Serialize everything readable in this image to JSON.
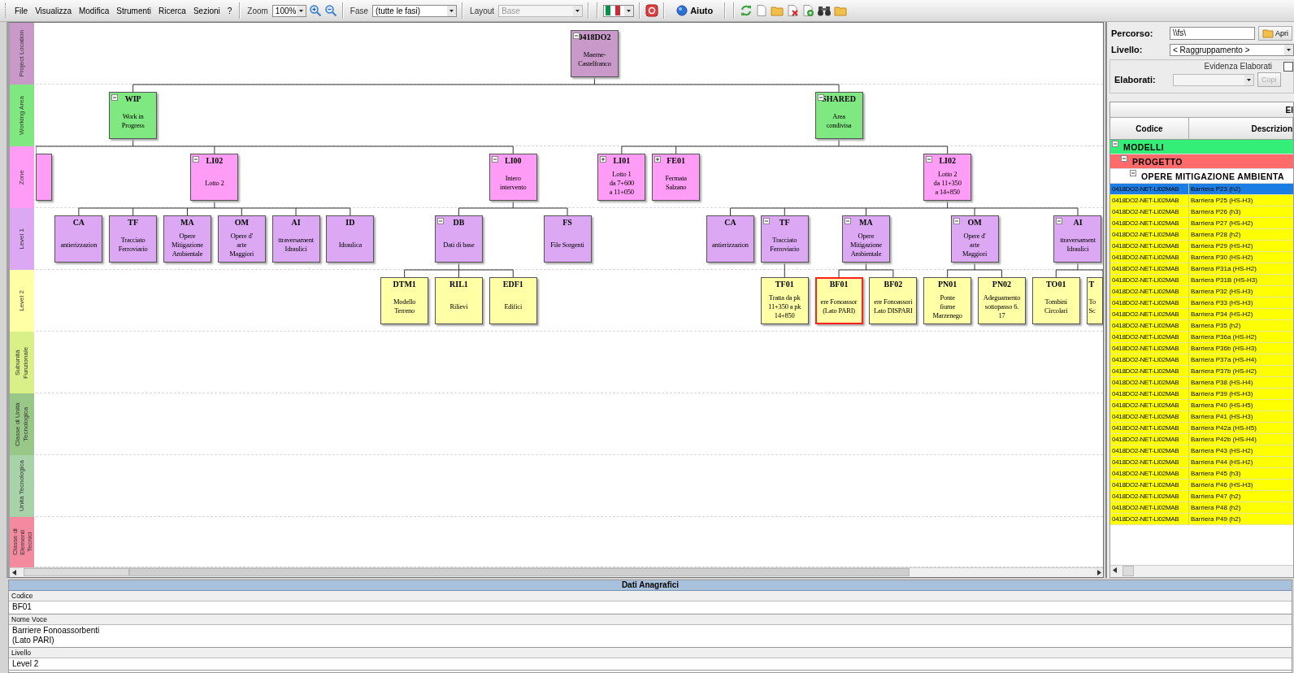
{
  "toolbar": {
    "menus": [
      "File",
      "Visualizza",
      "Modifica",
      "Strumenti",
      "Ricerca",
      "Sezioni",
      "?"
    ],
    "zoom": {
      "label": "Zoom",
      "value": "100%"
    },
    "phase": {
      "label": "Fase",
      "value": "(tutte le fasi)"
    },
    "layout": {
      "label": "Layout",
      "value": "Base",
      "disabled": true
    },
    "help_button": "Aiuto"
  },
  "bands": [
    {
      "label": "Project Location",
      "color": "#c99ac9"
    },
    {
      "label": "Working Area",
      "color": "#80e880"
    },
    {
      "label": "Zone",
      "color": "#ff9cf5"
    },
    {
      "label": "Level 1",
      "color": "#dca8f4"
    },
    {
      "label": "Level 2",
      "color": "#ffffa6"
    },
    {
      "label": "Subunità Funzionale",
      "color": "#d9ef88"
    },
    {
      "label": "Classe di Unità Tecnologica",
      "color": "#98c787"
    },
    {
      "label": "Unità Tecnologica",
      "color": "#a8d2a8"
    },
    {
      "label": "Classe di Elementi Tecnici",
      "color": "#f48aa0"
    }
  ],
  "tree": {
    "code": "0418DO2",
    "description": "Maerne-\nCastelfranco",
    "selected": false,
    "expanded": true,
    "children": [
      {
        "code": "WIP",
        "description": "Work in\nProgress",
        "selected": false,
        "expanded": true,
        "children": [
          {
            "kind": "clipped-left",
            "selected": false
          },
          {
            "code": "LI02",
            "description": "Lotto 2",
            "selected": false,
            "expanded": true,
            "children": [
              {
                "code": "CA",
                "description": "antierizzazion",
                "selected": false
              },
              {
                "code": "TF",
                "description": "Tracciato\nFerroviario",
                "selected": false
              },
              {
                "code": "MA",
                "description": "Opere\nMitigazione\nAmbientale",
                "selected": false
              },
              {
                "code": "OM",
                "description": "Opere d'\narte\nMaggiori",
                "selected": false
              },
              {
                "code": "AI",
                "description": "ttraversament\nIdraulici",
                "selected": false
              },
              {
                "code": "ID",
                "description": "Idraulica",
                "selected": false
              }
            ]
          },
          {
            "code": "LI00",
            "description": "Intero\nintervento",
            "selected": false,
            "expanded": true,
            "children": [
              {
                "code": "DB",
                "description": "Dati di base",
                "selected": false,
                "expanded": true,
                "children": [
                  {
                    "code": "DTM1",
                    "description": "Modello\nTerreno",
                    "selected": false
                  },
                  {
                    "code": "RIL1",
                    "description": "Rilievi",
                    "selected": false
                  },
                  {
                    "code": "EDF1",
                    "description": "Edifici",
                    "selected": false
                  }
                ]
              },
              {
                "code": "FS",
                "description": "File Sorgenti",
                "selected": false
              }
            ]
          }
        ]
      },
      {
        "code": "SHARED",
        "description": "Area\ncondivisa",
        "selected": false,
        "expanded": true,
        "children": [
          {
            "code": "LI01",
            "description": "Lotto 1\nda 7+600\na 11+050",
            "selected": false,
            "expanded": false
          },
          {
            "code": "FE01",
            "description": "Fermata\nSalzano",
            "selected": false,
            "expanded": false
          },
          {
            "code": "LI02",
            "description": "Lotto 2\nda 11+350\na 14+850",
            "selected": false,
            "expanded": true,
            "children": [
              {
                "code": "CA",
                "description": "antierizzazion",
                "selected": false
              },
              {
                "code": "TF",
                "description": "Tracciato\nFerroviario",
                "selected": false,
                "expanded": true,
                "children": [
                  {
                    "code": "TF01",
                    "description": "Tratta da pk\n11+350 a pk\n14+850",
                    "selected": false
                  }
                ]
              },
              {
                "code": "MA",
                "description": "Opere\nMitigazione\nAmbientale",
                "selected": false,
                "expanded": true,
                "children": [
                  {
                    "code": "BF01",
                    "description": "ere Fonoassor\n(Lato PARI)",
                    "selected": true
                  },
                  {
                    "code": "BF02",
                    "description": "ere Fonoassori\nLato DISPARI",
                    "selected": false
                  }
                ]
              },
              {
                "code": "OM",
                "description": "Opere d'\narte\nMaggiori",
                "selected": false,
                "expanded": true,
                "children": [
                  {
                    "code": "PN01",
                    "description": "Ponte\nfiume\nMarzenego",
                    "selected": false
                  },
                  {
                    "code": "PN02",
                    "description": "Adeguamento\nsottopasso 6.\n17",
                    "selected": false
                  }
                ]
              },
              {
                "code": "AI",
                "description": "ttraversament\nIdraulici",
                "selected": false,
                "expanded": true,
                "children": [
                  {
                    "code": "TO01",
                    "description": "Tombini\nCircolari",
                    "selected": false
                  },
                  {
                    "kind": "clipped-right",
                    "code": "T",
                    "description": "To\nSc",
                    "selected": false
                  }
                ]
              }
            ]
          }
        ]
      }
    ]
  },
  "side_panel": {
    "path": {
      "label": "Percorso:",
      "value": "\\\\fs\\"
    },
    "open_button": "Apri",
    "level": {
      "label": "Livello:",
      "value": "< Raggruppamento >"
    },
    "highlight": {
      "label": "Evidenza Elaborati",
      "checked": false
    },
    "elaborati": {
      "label": "Elaborati:",
      "disabled": true
    },
    "copy_button": {
      "label": "Copi",
      "disabled": true
    },
    "grid": {
      "band_header": "El",
      "columns": [
        "Codice",
        "Descrizion"
      ],
      "groups": [
        {
          "label": "MODELLI",
          "color": "#33ee77",
          "expanded": true,
          "children": [
            {
              "label": "PROGETTO",
              "color": "#ff6a6a",
              "expanded": true,
              "children": [
                {
                  "label": "OPERE MITIGAZIONE AMBIENTA",
                  "color": "#ffffff",
                  "expanded": true,
                  "rows": [
                    {
                      "code": "0418DO2-NET-LI02MAB",
                      "description": "Barriera P23 (h2)",
                      "selected": true
                    },
                    {
                      "code": "0418DO2-NET-LI02MAB",
                      "description": "Barriera P25 (HS-H3)",
                      "selected": false
                    },
                    {
                      "code": "0418DO2-NET-LI02MAB",
                      "description": "Barriera P26 (h3)",
                      "selected": false
                    },
                    {
                      "code": "0418DO2-NET-LI02MAB",
                      "description": "Barriera P27 (HS-H2)",
                      "selected": false
                    },
                    {
                      "code": "0418DO2-NET-LI02MAB",
                      "description": "Barriera P28 (h2)",
                      "selected": false
                    },
                    {
                      "code": "0418DO2-NET-LI02MAB",
                      "description": "Barriera P29 (HS-H2)",
                      "selected": false
                    },
                    {
                      "code": "0418DO2-NET-LI02MAB",
                      "description": "Barriera P30 (HS-H2)",
                      "selected": false
                    },
                    {
                      "code": "0418DO2-NET-LI02MAB",
                      "description": "Barriera P31a (HS-H2)",
                      "selected": false
                    },
                    {
                      "code": "0418DO2-NET-LI02MAB",
                      "description": "Barriera P31B (HS-H3)",
                      "selected": false
                    },
                    {
                      "code": "0418DO2-NET-LI02MAB",
                      "description": "Barriera P32 (HS-H3)",
                      "selected": false
                    },
                    {
                      "code": "0418DO2-NET-LI02MAB",
                      "description": "Barriera P33 (HS-H3)",
                      "selected": false
                    },
                    {
                      "code": "0418DO2-NET-LI02MAB",
                      "description": "Barriera P34 (HS-H2)",
                      "selected": false
                    },
                    {
                      "code": "0418DO2-NET-LI02MAB",
                      "description": "Barriera P35 (h2)",
                      "selected": false
                    },
                    {
                      "code": "0418DO2-NET-LI02MAB",
                      "description": "Barriera P36a (HS-H2)",
                      "selected": false
                    },
                    {
                      "code": "0418DO2-NET-LI02MAB",
                      "description": "Barriera P36b (HS-H3)",
                      "selected": false
                    },
                    {
                      "code": "0418DO2-NET-LI02MAB",
                      "description": "Barriera P37a (HS-H4)",
                      "selected": false
                    },
                    {
                      "code": "0418DO2-NET-LI02MAB",
                      "description": "Barriera P37b (HS-H2)",
                      "selected": false
                    },
                    {
                      "code": "0418DO2-NET-LI02MAB",
                      "description": "Barriera P38 (HS-H4)",
                      "selected": false
                    },
                    {
                      "code": "0418DO2-NET-LI02MAB",
                      "description": "Barriera P39 (HS-H3)",
                      "selected": false
                    },
                    {
                      "code": "0418DO2-NET-LI02MAB",
                      "description": "Barriera P40 (HS-H5)",
                      "selected": false
                    },
                    {
                      "code": "0418DO2-NET-LI02MAB",
                      "description": "Barriera P41 (HS-H3)",
                      "selected": false
                    },
                    {
                      "code": "0418DO2-NET-LI02MAB",
                      "description": "Barriera P42a (HS-H5)",
                      "selected": false
                    },
                    {
                      "code": "0418DO2-NET-LI02MAB",
                      "description": "Barriera P42b (HS-H4)",
                      "selected": false
                    },
                    {
                      "code": "0418DO2-NET-LI02MAB",
                      "description": "Barriera P43 (HS-H2)",
                      "selected": false
                    },
                    {
                      "code": "0418DO2-NET-LI02MAB",
                      "description": "Barriera P44 (HS-H2)",
                      "selected": false
                    },
                    {
                      "code": "0418DO2-NET-LI02MAB",
                      "description": "Barriera P45 (h3)",
                      "selected": false
                    },
                    {
                      "code": "0418DO2-NET-LI02MAB",
                      "description": "Barriera P46 (HS-H3)",
                      "selected": false
                    },
                    {
                      "code": "0418DO2-NET-LI02MAB",
                      "description": "Barriera P47 (h2)",
                      "selected": false
                    },
                    {
                      "code": "0418DO2-NET-LI02MAB",
                      "description": "Barriera P48 (h2)",
                      "selected": false
                    },
                    {
                      "code": "0418DO2-NET-LI02MAB",
                      "description": "Barriera P49 (h2)",
                      "selected": false
                    }
                  ]
                }
              ]
            }
          ]
        }
      ]
    }
  },
  "details": {
    "title": "Dati Anagrafici",
    "fields": [
      {
        "label": "Codice",
        "value": "BF01"
      },
      {
        "label": "Nome Voce",
        "value": "Barriere Fonoassorbenti\n(Lato PARI)"
      },
      {
        "label": "Livello",
        "value": "Level 2"
      }
    ]
  }
}
